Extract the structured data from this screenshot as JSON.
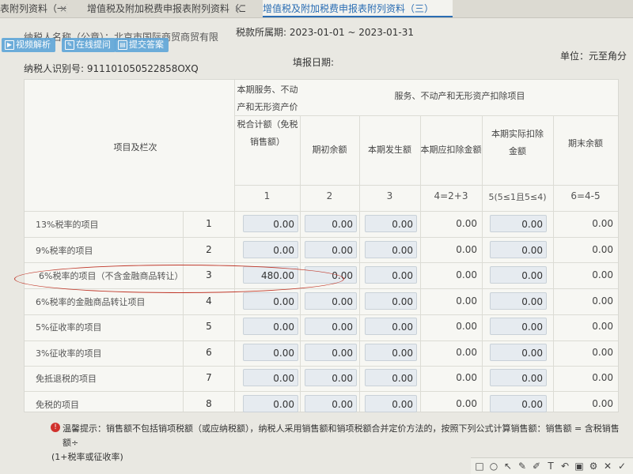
{
  "tabs": [
    {
      "label": "表附列资料（一）",
      "close": "×"
    },
    {
      "label": "增值税及附加税费申报表附列资料（二）",
      "close": "×"
    },
    {
      "label": "增值税及附加税费申报表附列资料（三）",
      "close": ""
    }
  ],
  "header": {
    "taxpayer_name": "纳税人名称（公章）：北京市国际商贸商贸有限",
    "period_label": "税款所属期:",
    "period_value": "2023-01-01 ~ 2023-01-31",
    "unit": "单位：元至角分",
    "fill_date_label": "填报日期:",
    "tax_id_label": "纳税人识别号:",
    "tax_id_value": "911101050522858OXQ"
  },
  "buttons": {
    "video": "视频解析",
    "online": "在线提问",
    "submit": "提交答案"
  },
  "table": {
    "item_header": "项目及栏次",
    "col1_header": "本期服务、不动产和无形资产价税合计额（免税销售额）",
    "group_header": "服务、不动产和无形资产扣除项目",
    "col2_header": "期初余额",
    "col3_header": "本期发生额",
    "col4_header": "本期应扣除金额",
    "col5_header": "本期实际扣除金额",
    "col6_header": "期末余额",
    "col_numbers": [
      "1",
      "2",
      "3",
      "4=2+3",
      "5(5≤1且5≤4)",
      "6=4-5"
    ],
    "rows": [
      {
        "label": "13%税率的项目",
        "num": "1",
        "c1": "0.00",
        "c2": "0.00",
        "c3": "0.00",
        "c4": "0.00",
        "c5": "0.00",
        "c6": "0.00"
      },
      {
        "label": "9%税率的项目",
        "num": "2",
        "c1": "0.00",
        "c2": "0.00",
        "c3": "0.00",
        "c4": "0.00",
        "c5": "0.00",
        "c6": "0.00"
      },
      {
        "label": "6%税率的项目（不含金融商品转让）",
        "num": "3",
        "c1": "480.00",
        "c2": "0.00",
        "c3": "0.00",
        "c4": "0.00",
        "c5": "0.00",
        "c6": "0.00"
      },
      {
        "label": "6%税率的金融商品转让项目",
        "num": "4",
        "c1": "0.00",
        "c2": "0.00",
        "c3": "0.00",
        "c4": "0.00",
        "c5": "0.00",
        "c6": "0.00"
      },
      {
        "label": "5%征收率的项目",
        "num": "5",
        "c1": "0.00",
        "c2": "0.00",
        "c3": "0.00",
        "c4": "0.00",
        "c5": "0.00",
        "c6": "0.00"
      },
      {
        "label": "3%征收率的项目",
        "num": "6",
        "c1": "0.00",
        "c2": "0.00",
        "c3": "0.00",
        "c4": "0.00",
        "c5": "0.00",
        "c6": "0.00"
      },
      {
        "label": "免抵退税的项目",
        "num": "7",
        "c1": "0.00",
        "c2": "0.00",
        "c3": "0.00",
        "c4": "0.00",
        "c5": "0.00",
        "c6": "0.00"
      },
      {
        "label": "免税的项目",
        "num": "8",
        "c1": "0.00",
        "c2": "0.00",
        "c3": "0.00",
        "c4": "0.00",
        "c5": "0.00",
        "c6": "0.00"
      }
    ]
  },
  "note": {
    "line1": "温馨提示：销售额不包括销项税额（或应纳税额），纳税人采用销售额和销项税额合并定价方法的，按照下列公式计算销售额：销售额 = 含税销售额÷",
    "line2": "(1+税率或征收率)"
  },
  "colors": {
    "accent": "#2a6db3",
    "highlight_oval": "#c0392b",
    "button": "#5fa6d9"
  }
}
